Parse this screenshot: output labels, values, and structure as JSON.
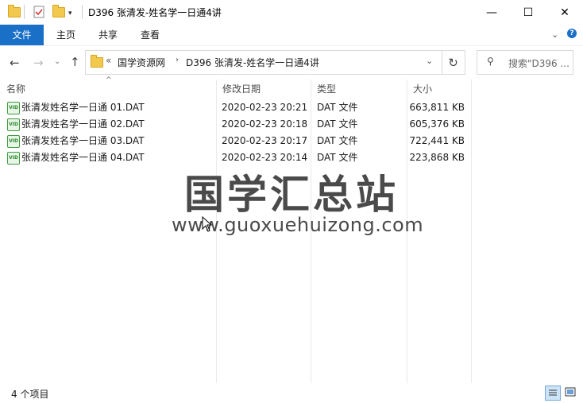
{
  "window": {
    "title": "D396 张清发-姓名学一日通4讲",
    "minimize": "—",
    "maximize": "☐",
    "close": "✕"
  },
  "ribbon": {
    "tabs": [
      "文件",
      "主页",
      "共享",
      "查看"
    ]
  },
  "address": {
    "prefix": "«",
    "crumbs": [
      "国学资源网",
      "D396 张清发-姓名学一日通4讲"
    ],
    "search_placeholder": "搜索\"D396 ..."
  },
  "columns": [
    "名称",
    "修改日期",
    "类型",
    "大小"
  ],
  "files": [
    {
      "name": "张清发姓名学一日通 01.DAT",
      "date": "2020-02-23 20:21",
      "type": "DAT 文件",
      "size": "663,811 KB"
    },
    {
      "name": "张清发姓名学一日通 02.DAT",
      "date": "2020-02-23 20:18",
      "type": "DAT 文件",
      "size": "605,376 KB"
    },
    {
      "name": "张清发姓名学一日通 03.DAT",
      "date": "2020-02-23 20:17",
      "type": "DAT 文件",
      "size": "722,441 KB"
    },
    {
      "name": "张清发姓名学一日通 04.DAT",
      "date": "2020-02-23 20:14",
      "type": "DAT 文件",
      "size": "223,868 KB"
    }
  ],
  "watermark": {
    "title": "国学汇总站",
    "url": "www.guoxuehuizong.com"
  },
  "status": {
    "count": "4 个项目"
  }
}
